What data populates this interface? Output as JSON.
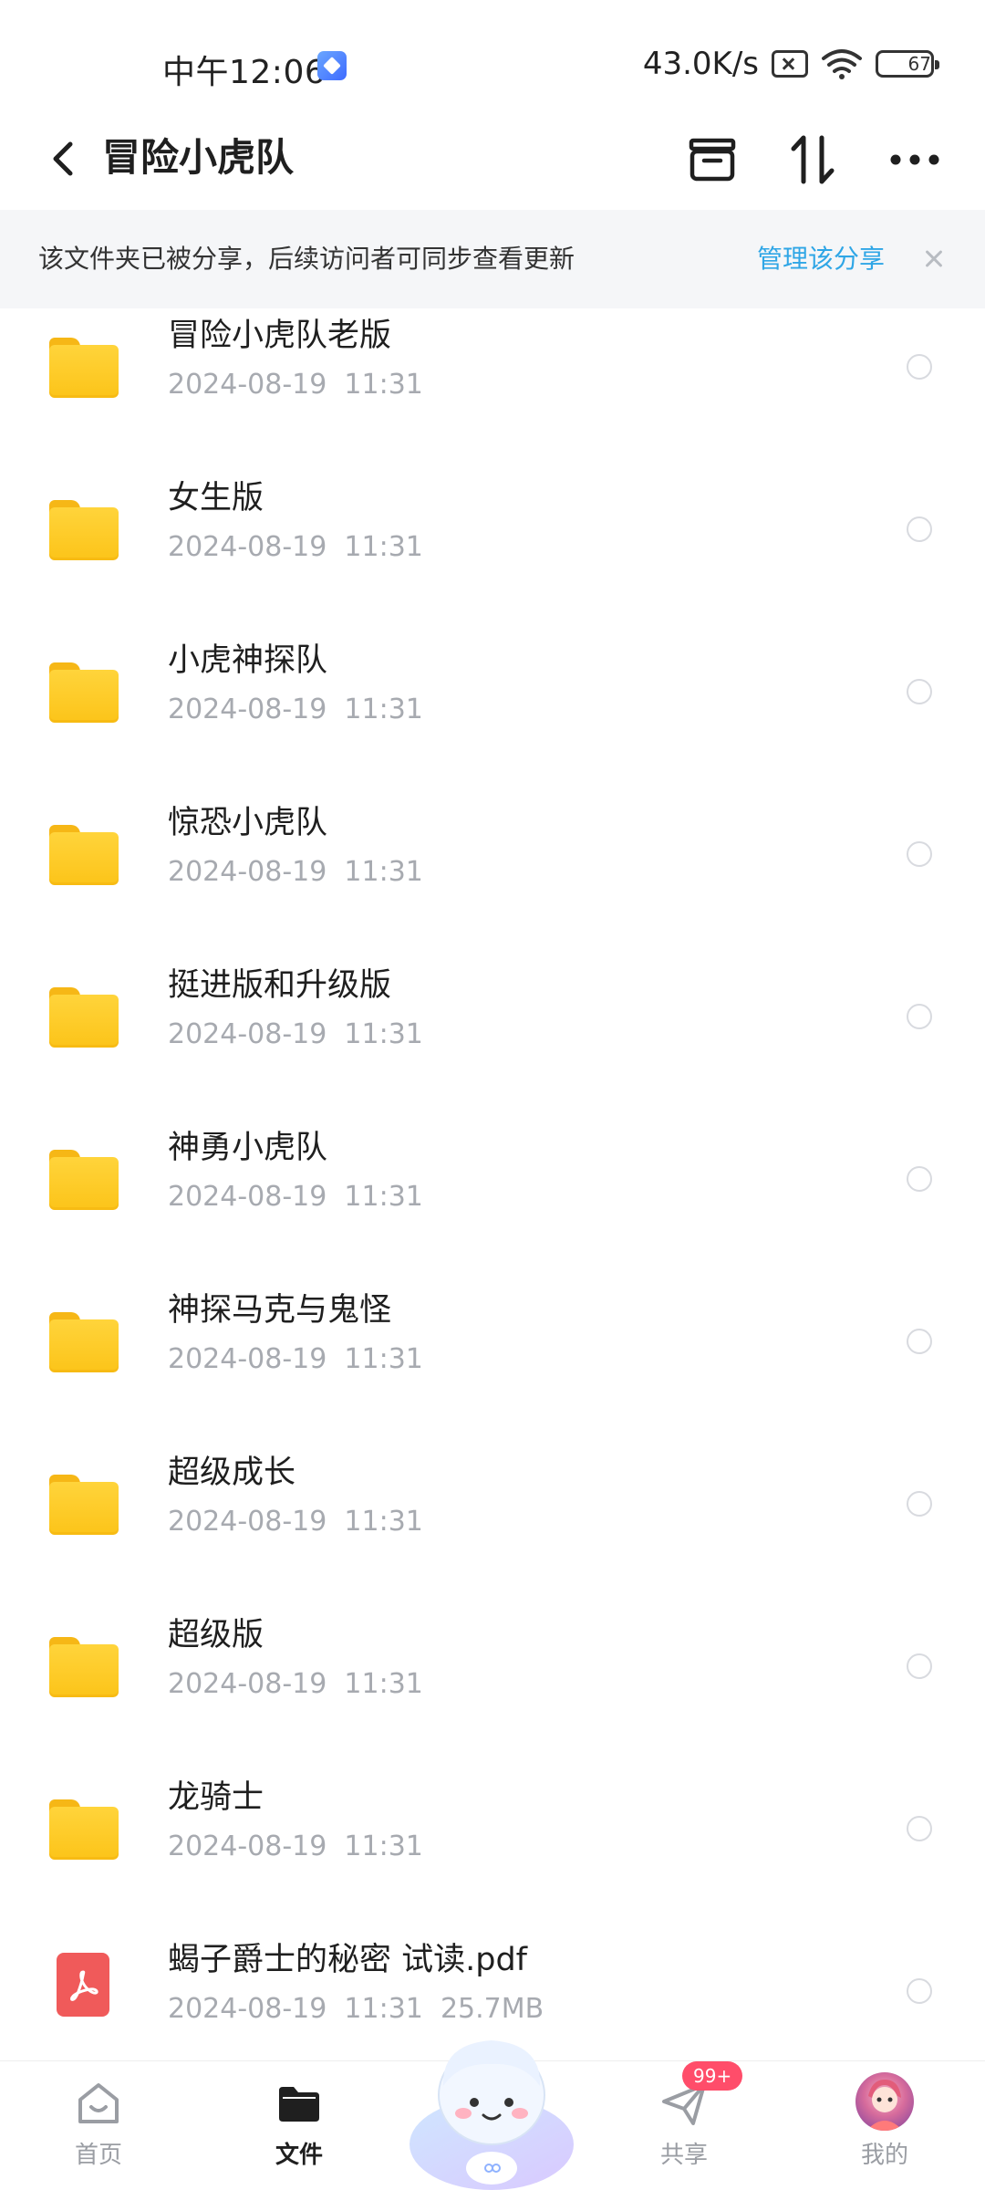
{
  "status_bar": {
    "time": "中午12:06",
    "network_speed": "43.0K/s",
    "battery_level": "67"
  },
  "header": {
    "title": "冒险小虎队"
  },
  "share_banner": {
    "message": "该文件夹已被分享，后续访问者可同步查看更新",
    "manage_link": "管理该分享"
  },
  "files": [
    {
      "name": "冒险小虎队老版",
      "meta": "2024-08-19  11:31",
      "type": "folder"
    },
    {
      "name": "女生版",
      "meta": "2024-08-19  11:31",
      "type": "folder"
    },
    {
      "name": "小虎神探队",
      "meta": "2024-08-19  11:31",
      "type": "folder"
    },
    {
      "name": "惊恐小虎队",
      "meta": "2024-08-19  11:31",
      "type": "folder"
    },
    {
      "name": "挺进版和升级版",
      "meta": "2024-08-19  11:31",
      "type": "folder"
    },
    {
      "name": "神勇小虎队",
      "meta": "2024-08-19  11:31",
      "type": "folder"
    },
    {
      "name": "神探马克与鬼怪",
      "meta": "2024-08-19  11:31",
      "type": "folder"
    },
    {
      "name": "超级成长",
      "meta": "2024-08-19  11:31",
      "type": "folder"
    },
    {
      "name": "超级版",
      "meta": "2024-08-19  11:31",
      "type": "folder"
    },
    {
      "name": "龙骑士",
      "meta": "2024-08-19  11:31",
      "type": "folder"
    },
    {
      "name": "蝎子爵士的秘密 试读.pdf",
      "meta": "2024-08-19  11:31  25.7MB",
      "type": "pdf"
    }
  ],
  "bottom_nav": {
    "home": "首页",
    "files": "文件",
    "share": "共享",
    "share_badge": "99+",
    "mine": "我的"
  },
  "colors": {
    "accent": "#2fa6e6",
    "folder": "#fcc419",
    "pdf": "#f05a5a",
    "badge": "#ff4d6a"
  }
}
